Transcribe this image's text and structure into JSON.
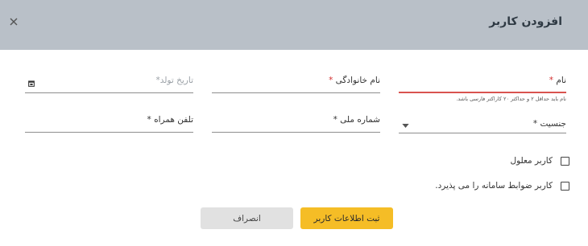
{
  "dialog": {
    "title": "افزودن کاربر",
    "close_symbol": "×"
  },
  "form": {
    "first_name": {
      "label": "نام",
      "required_mark": "*",
      "hint": "نام باید حداقل ۲ و حداکثر ۲۰ کاراکتر فارسی باشد."
    },
    "last_name": {
      "label": "نام خانوادگی",
      "required_mark": "*"
    },
    "birth_date": {
      "label": "تاریخ تولد",
      "required_mark": "*",
      "icon": "calendar-icon"
    },
    "gender": {
      "label": "جنسیت",
      "required_mark": "*",
      "icon": "dropdown-arrow-icon"
    },
    "national_id": {
      "label": "شماره ملی",
      "required_mark": "*"
    },
    "mobile": {
      "label": "تلفن همراه",
      "required_mark": "*"
    },
    "disabled_user": {
      "label": "کاربر معلول",
      "checked": false
    },
    "accept_terms": {
      "label": "کاربر ضوابط سامانه را می پذیرد.",
      "checked": false
    }
  },
  "buttons": {
    "submit": "ثبت اطلاعات کاربر",
    "cancel": "انصراف"
  },
  "colors": {
    "header_bg": "#b9c0c8",
    "accent": "#f5bd26",
    "error": "#d9534f"
  }
}
